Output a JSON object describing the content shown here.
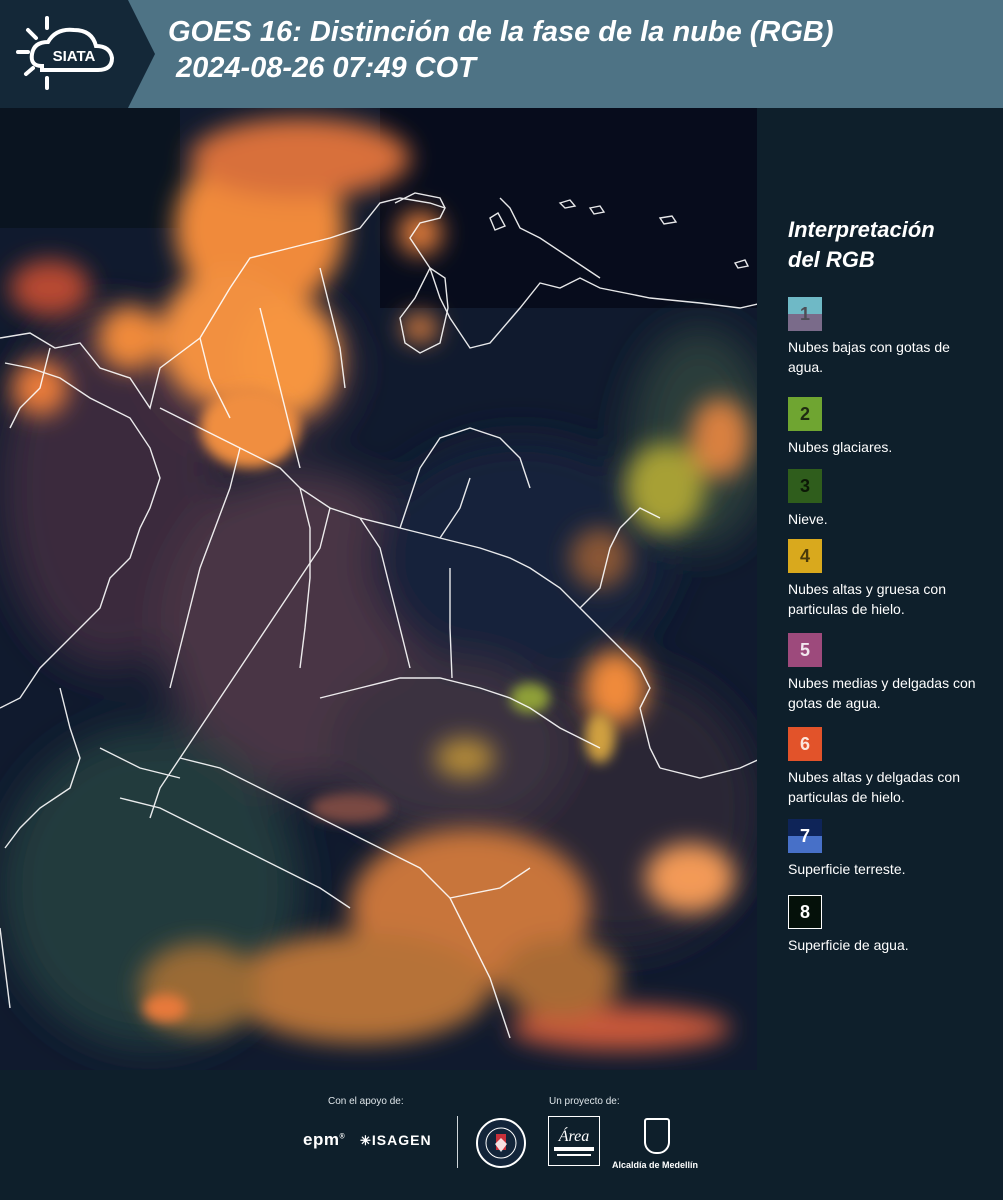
{
  "header": {
    "logo_text": "SIATA",
    "title_line1": "GOES 16: Distinción de la fase de la nube (RGB)",
    "title_line2": "2024-08-26 07:49 COT",
    "background_color": "#4e7385"
  },
  "legend": {
    "title_line1": "Interpretación",
    "title_line2": "del RGB",
    "items": [
      {
        "number": "1",
        "label": "Nubes bajas con gotas de agua.",
        "color_top": "#6fb9c6",
        "color_bottom": "#7a6b8a"
      },
      {
        "number": "2",
        "label": "Nubes glaciares.",
        "color_top": "#6fa531",
        "color_bottom": "#6fa531"
      },
      {
        "number": "3",
        "label": "Nieve.",
        "color_top": "#2f5d1c",
        "color_bottom": "#2f5d1c"
      },
      {
        "number": "4",
        "label": "Nubes altas y gruesa con particulas de hielo.",
        "color_top": "#d9a91d",
        "color_bottom": "#d9a91d"
      },
      {
        "number": "5",
        "label": "Nubes medias y delgadas con gotas de agua.",
        "color_top": "#9d4a7c",
        "color_bottom": "#9d4a7c"
      },
      {
        "number": "6",
        "label": "Nubes altas y delgadas con particulas de hielo.",
        "color_top": "#e2532a",
        "color_bottom": "#e2532a"
      },
      {
        "number": "7",
        "label": "Superficie terreste.",
        "color_top": "#0e2458",
        "color_bottom": "#4770c8"
      },
      {
        "number": "8",
        "label": "Superficie de agua.",
        "color_top": "#05110a",
        "color_bottom": "#05110a"
      }
    ]
  },
  "footer": {
    "support_label": "Con el apoyo de:",
    "project_label": "Un proyecto de:",
    "epm_logo": "epm",
    "isagen_logo": "ISAGEN",
    "area_logo_text": "Área",
    "alcaldia_text": "Alcaldía de Medellín"
  }
}
